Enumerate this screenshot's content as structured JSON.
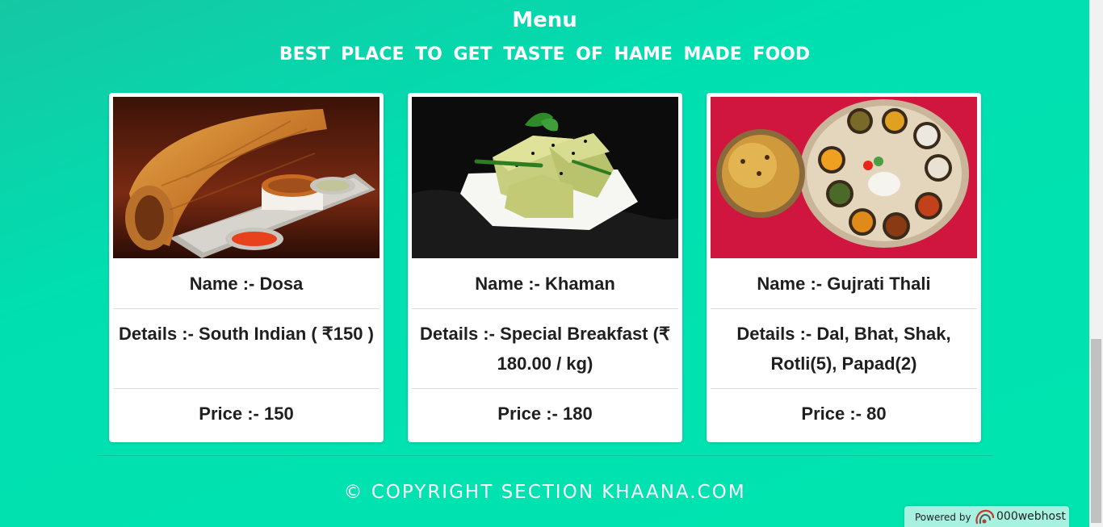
{
  "header": {
    "title": "Menu",
    "subtitle": "BEST PLACE TO GET TASTE OF HAME MADE FOOD"
  },
  "menu_items": [
    {
      "image": "dosa-photo",
      "name": "Name :- Dosa",
      "details": "Details :- South Indian ( ₹150 )",
      "price": "Price :- 150"
    },
    {
      "image": "khaman-photo",
      "name": "Name :- Khaman",
      "details": "Details :- Special Breakfast (₹ 180.00 / kg)",
      "price": "Price :- 180"
    },
    {
      "image": "gujrati-thali-photo",
      "name": "Name :- Gujrati Thali",
      "details": "Details :- Dal, Bhat, Shak, Rotli(5), Papad(2)",
      "price": "Price :- 80"
    }
  ],
  "footer": {
    "copyright": "© COPYRIGHT SECTION KHAANA.COM"
  },
  "badge": {
    "powered_by": "Powered by",
    "brand": "000webhost"
  },
  "colors": {
    "background": "#00e5b0",
    "card": "#ffffff",
    "text": "#1f1f1f"
  }
}
